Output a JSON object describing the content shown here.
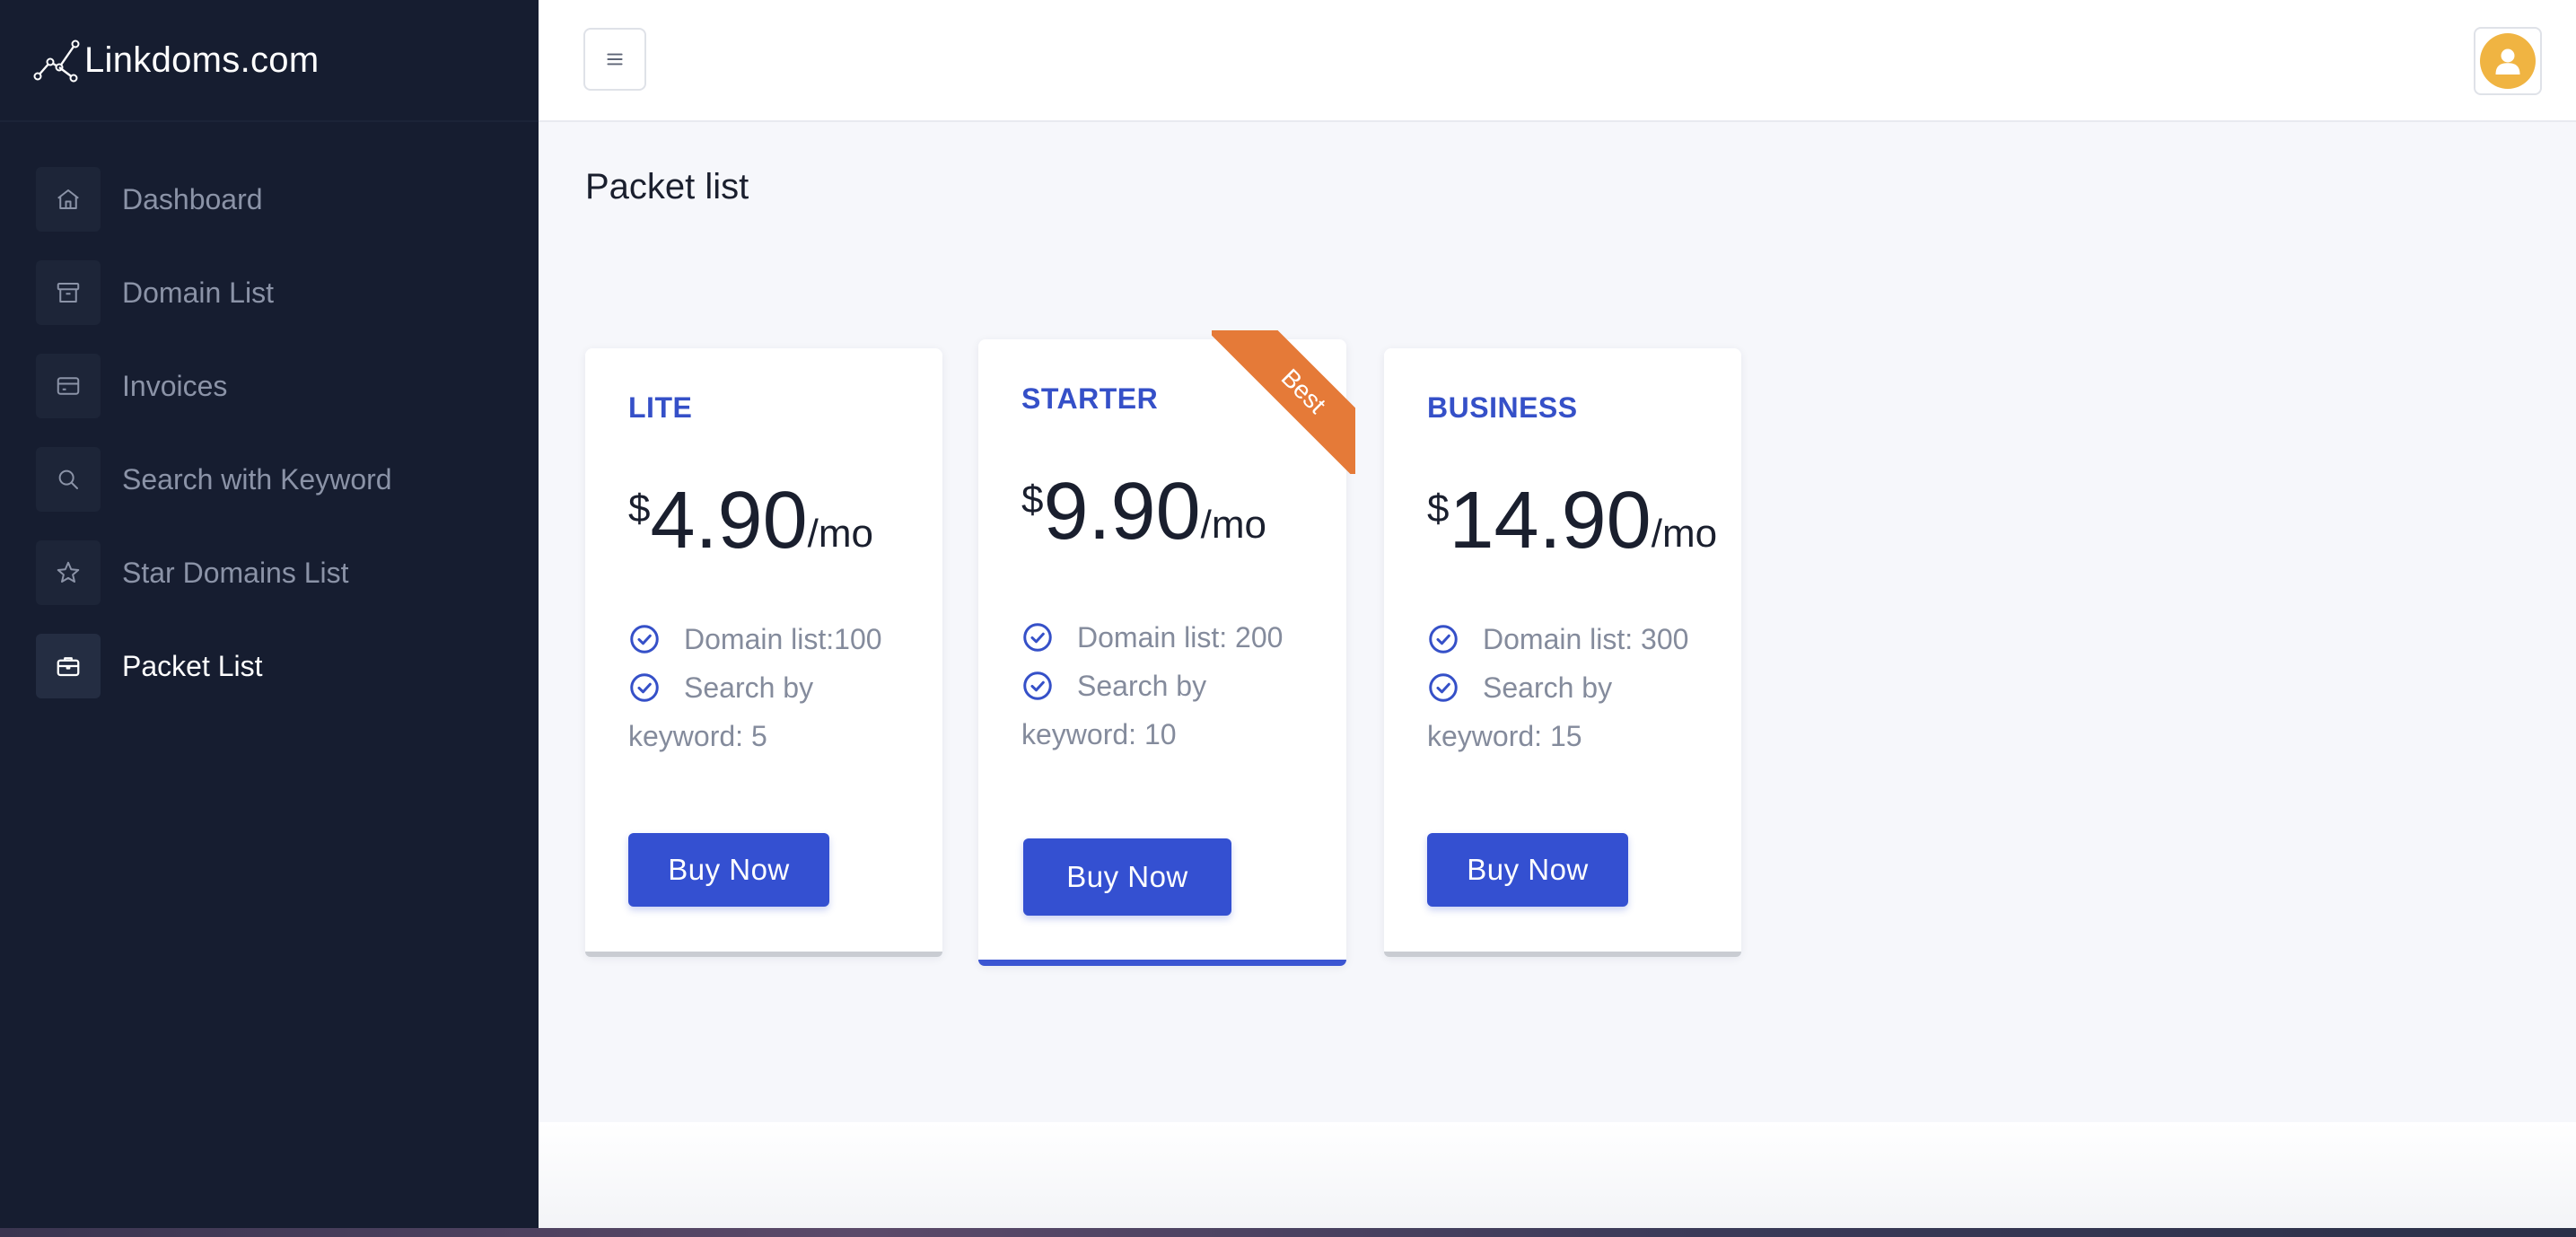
{
  "brand": {
    "name": "Linkdoms.com",
    "icon": "chart-line-logo-icon"
  },
  "sidebar": {
    "items": [
      {
        "label": "Dashboard",
        "icon": "home-icon",
        "active": false
      },
      {
        "label": "Domain List",
        "icon": "archive-icon",
        "active": false
      },
      {
        "label": "Invoices",
        "icon": "credit-card-icon",
        "active": false
      },
      {
        "label": "Search with Keyword",
        "icon": "search-icon",
        "active": false
      },
      {
        "label": "Star Domains List",
        "icon": "star-icon",
        "active": false
      },
      {
        "label": "Packet List",
        "icon": "briefcase-icon",
        "active": true
      }
    ]
  },
  "topbar": {
    "menu_icon": "hamburger-icon",
    "avatar_icon": "user-avatar-icon"
  },
  "page": {
    "title": "Packet list"
  },
  "plans": [
    {
      "name": "LITE",
      "currency": "$",
      "price": "4.90",
      "period": "/mo",
      "features": [
        "Domain list:100",
        "Search by keyword: 5"
      ],
      "button": "Buy Now",
      "featured": false
    },
    {
      "name": "STARTER",
      "currency": "$",
      "price": "9.90",
      "period": "/mo",
      "features": [
        "Domain list: 200",
        "Search by keyword: 10"
      ],
      "button": "Buy Now",
      "featured": true,
      "ribbon": "Best"
    },
    {
      "name": "BUSINESS",
      "currency": "$",
      "price": "14.90",
      "period": "/mo",
      "features": [
        "Domain list: 300",
        "Search by keyword: 15"
      ],
      "button": "Buy Now",
      "featured": false
    }
  ],
  "colors": {
    "sidebar_bg": "#161d30",
    "accent": "#3450d1",
    "ribbon": "#e57a38",
    "plan_name": "#3550c8",
    "avatar": "#f0b442"
  }
}
